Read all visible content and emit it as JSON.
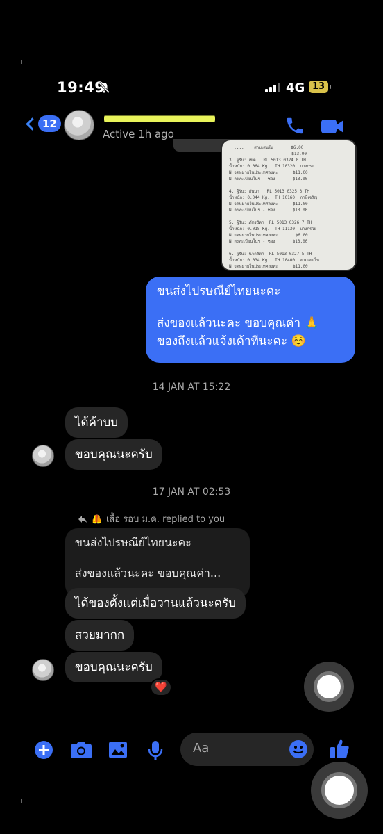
{
  "status_bar": {
    "time": "19:49",
    "network": "4G",
    "battery": "13"
  },
  "header": {
    "back_count": "12",
    "active_status": "Active 1h ago"
  },
  "colors": {
    "accent": "#3b6ff5",
    "bubble_gray": "#262626",
    "background": "#000000"
  },
  "messages": {
    "sent_line1": "ขนส่งไปรษณีย์ไทยนะคะ",
    "sent_line2": "ส่งของแล้วนะคะ ขอบคุณค่า 🙏",
    "sent_line3": "ของถึงแล้วแจ้งเค้าทีนะคะ ☺️",
    "timestamp1": "14 JAN AT 15:22",
    "recv1": "ได้ค้าบบ",
    "recv2": "ขอบคุณนะครับ",
    "timestamp2": "17 JAN AT 02:53",
    "reply_header": "เสื้อ รอบ ม.ค. replied to you",
    "quote_line1": "ขนส่งไปรษณีย์ไทยนะคะ",
    "quote_line2": "ส่งของแล้วนะคะ ขอบคุณค่า...",
    "recv3": "ได้ของตั้งแต่เมื่อวานแล้วนะครับ",
    "recv4": "สวยมากก",
    "recv5": "ขอบคุณนะครับ",
    "reaction": "❤️"
  },
  "receipt_text": {
    "lines": [
      "  ....    สามเสนใน       ฿6.00",
      "                         ฿13.00",
      "3. ผู้รับ: เขต   RL 5013 0324 0 TH",
      "น้ำหนัก: 0.064 Kg.  TH 10320  บางกระ",
      "N จดหมายในประเทศลงทะ      ฿11.00",
      "N ลงทะเบียนในฯ - ซอง       ฿13.00",
      "",
      "4. ผู้รับ: อันนา   RL 5013 0325 3 TH",
      "น้ำหนัก: 0.044 Kg.  TH 10160  ภาษีเจริญ",
      "N จดหมายในประเทศลงทะ      ฿11.00",
      "N ลงทะเบียนในฯ - ซอง       ฿13.00",
      "",
      "5. ผู้รับ: ภัทรธิดา  RL 5013 0326 7 TH",
      "น้ำหนัก: 0.018 Kg.  TH 11130  บางกรวย",
      "N จดหมายในประเทศลงทะ       ฿6.00",
      "N ลงทะเบียนในฯ - ซอง       ฿13.00",
      "",
      "6. ผู้รับ: นาถลิตา  RL 5013 0327 5 TH",
      "น้ำหนัก: 0.034 Kg.  TH 10400  สามเสนใน",
      "N จดหมายในประเทศลงทะ      ฿11.00"
    ]
  },
  "composer": {
    "placeholder": "Aa"
  }
}
